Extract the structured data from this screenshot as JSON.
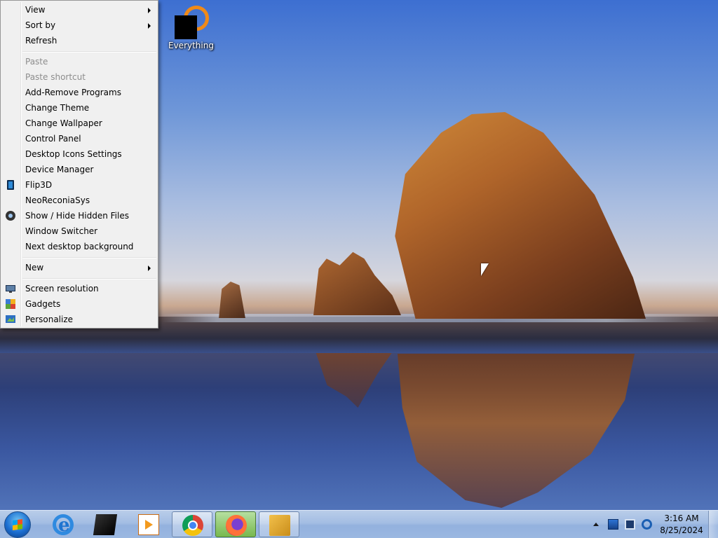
{
  "desktop": {
    "icons": [
      {
        "label": "Everything"
      }
    ]
  },
  "context_menu": {
    "items": [
      {
        "label": "View",
        "submenu": true
      },
      {
        "label": "Sort by",
        "submenu": true
      },
      {
        "label": "Refresh"
      },
      {
        "label": "Paste",
        "disabled": true
      },
      {
        "label": "Paste shortcut",
        "disabled": true
      },
      {
        "label": "Add-Remove Programs"
      },
      {
        "label": "Change Theme"
      },
      {
        "label": "Change Wallpaper"
      },
      {
        "label": "Control Panel"
      },
      {
        "label": "Desktop Icons Settings"
      },
      {
        "label": "Device Manager"
      },
      {
        "label": "Flip3D",
        "icon": "flip3d-icon"
      },
      {
        "label": "NeoReconiaSys"
      },
      {
        "label": "Show / Hide Hidden Files",
        "icon": "hidden-files-icon"
      },
      {
        "label": "Window Switcher"
      },
      {
        "label": "Next desktop background"
      },
      {
        "label": "New",
        "submenu": true
      },
      {
        "label": "Screen resolution",
        "icon": "screen-resolution-icon"
      },
      {
        "label": "Gadgets",
        "icon": "gadgets-icon"
      },
      {
        "label": "Personalize",
        "icon": "personalize-icon"
      }
    ]
  },
  "taskbar": {
    "start_icon": "windows-start-orb-icon",
    "pinned": [
      {
        "icon": "internet-explorer-icon"
      },
      {
        "icon": "box-icon"
      },
      {
        "icon": "media-player-icon"
      },
      {
        "icon": "chrome-icon",
        "state": "open"
      },
      {
        "icon": "firefox-icon",
        "state": "active"
      },
      {
        "icon": "file-manager-icon",
        "state": "open"
      }
    ],
    "tray": {
      "icons": [
        "show-hidden-icons-arrow",
        "tray-app-icon",
        "display-icon",
        "network-icon"
      ],
      "time": "3:16 AM",
      "date": "8/25/2024"
    }
  }
}
